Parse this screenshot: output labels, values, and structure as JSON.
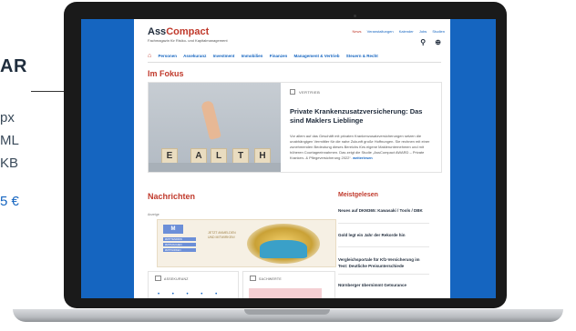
{
  "left_panel": {
    "title": "AR",
    "specs": [
      "px",
      "ML",
      "KB"
    ],
    "price": "5 €"
  },
  "website": {
    "logo_main": "Ass",
    "logo_accent": "Compact",
    "tagline": "Fachmagazin für Risiko- und Kapitalmanagement",
    "top_links": [
      "News",
      "Veranstaltungen",
      "Kalender",
      "Jobs",
      "Studien"
    ],
    "nav": [
      "Personen",
      "Assekuranz",
      "Investment",
      "Immobilien",
      "Finanzen",
      "Management & Vertrieb",
      "Steuern & Recht"
    ],
    "fokus_title": "Im Fokus",
    "feature": {
      "rubric": "VERTRIEB",
      "title": "Private Krankenzusatzversicherung: Das sind Maklers Lieblinge",
      "text": "Vor allem auf das Geschäft mit privaten Krankenzusatzversicherungen setzen die unabhängigen Vermittler für die nahe Zukunft große Hoffnungen. Sie rechnen mit einer zunehmenden Bedeutung dieses Bereichs fürs eigene Maklerunternehmen und mit höheren Courtageeinnahmen. Das zeigt die Studie „AssCompact AWARD – Private Kranken- & Pflegeversicherung 2022“.",
      "more": "weiterlesen",
      "image_letters": [
        "E",
        "A",
        "L",
        "T",
        "H"
      ]
    },
    "news_title": "Nachrichten",
    "ad": {
      "label": "Anzeige",
      "logo": "M",
      "tags": [
        "#MITTENDRIN",
        "#MITMACHEN",
        "#MITWIRKEN"
      ],
      "text": "JETZT ANMELDEN UND MITWIRKEN!"
    },
    "cards": [
      {
        "label": "ASSEKURANZ"
      },
      {
        "label": "SACHWERTE"
      }
    ],
    "sidebar_title": "Meistgelesen",
    "most_read": [
      "Neues auf DKM365: Kawasaki / Tools / DBK",
      "Gold legt ein Jahr der Rekorde hin",
      "Vergleichsportale für Kfz-Versicherung im Test: Deutliche Preisunterschiede",
      "Nürnberger übernimmt Getsurance"
    ]
  }
}
